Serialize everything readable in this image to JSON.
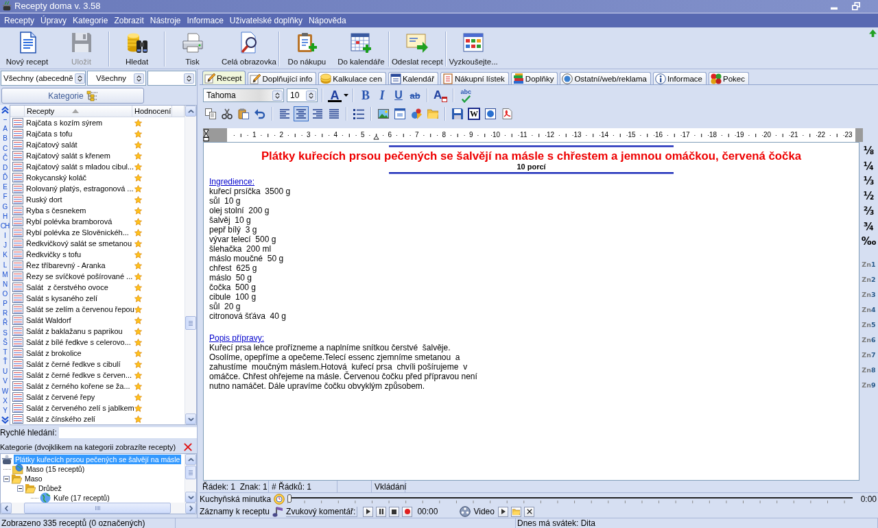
{
  "window": {
    "title": "Recepty doma v. 3.58"
  },
  "menu": [
    "Recepty",
    "Úpravy",
    "Kategorie",
    "Zobrazit",
    "Nástroje",
    "Informace",
    "Uživatelské doplňky",
    "Nápověda"
  ],
  "toolbar": {
    "groups": [
      [
        {
          "label": "Nový recept",
          "kind": "document",
          "disabled": false
        },
        {
          "label": "Uložit",
          "kind": "floppy",
          "disabled": true
        }
      ],
      [
        {
          "label": "Hledat",
          "kind": "binoculars",
          "disabled": false
        }
      ],
      [
        {
          "label": "Tisk",
          "kind": "printer",
          "disabled": false
        },
        {
          "label": "Celá obrazovka",
          "kind": "magnifier",
          "disabled": false
        }
      ],
      [
        {
          "label": "Do nákupu",
          "kind": "clipboard",
          "disabled": false
        },
        {
          "label": "Do kalendáře",
          "kind": "calendar",
          "disabled": false
        }
      ],
      [
        {
          "label": "Odeslat recept",
          "kind": "envelope",
          "disabled": false
        }
      ],
      [
        {
          "label": "Vyzkoušejte...",
          "kind": "grid",
          "disabled": false
        }
      ]
    ]
  },
  "filters": [
    "Všechny (abecedně",
    "Všechny"
  ],
  "category_button": {
    "label": "Kategorie"
  },
  "alphabet": [
    "--",
    "A",
    "B",
    "C",
    "Č",
    "D",
    "Ď",
    "E",
    "F",
    "G",
    "H",
    "CH",
    "I",
    "J",
    "K",
    "L",
    "M",
    "N",
    "O",
    "P",
    "R",
    "Ř",
    "S",
    "Š",
    "T",
    "Ť",
    "U",
    "V",
    "W",
    "X",
    "Y"
  ],
  "recipe_list": {
    "columns": [
      "Recepty",
      "Hodnocení"
    ],
    "rows": [
      {
        "name": "Rajčata s kozím sýrem"
      },
      {
        "name": "Rajčata s tofu"
      },
      {
        "name": "Rajčatový salát"
      },
      {
        "name": "Rajčatový salát s křenem"
      },
      {
        "name": "Rajčatový salát s mladou cibul..."
      },
      {
        "name": "Rokycanský koláč"
      },
      {
        "name": "Rolovaný platýs, estragonová ..."
      },
      {
        "name": "Ruský dort"
      },
      {
        "name": "Ryba s česnekem"
      },
      {
        "name": "Rybí polévka bramborová"
      },
      {
        "name": "Rybí polévka ze Slověnickéh..."
      },
      {
        "name": "Ředkvičkový salát se smetanou"
      },
      {
        "name": "Ředkvičky s tofu"
      },
      {
        "name": "Řez tříbarevný - Aranka"
      },
      {
        "name": "Řezy se svíčkové pošírované ..."
      },
      {
        "name": "Salát  z čerstvého ovoce"
      },
      {
        "name": "Salát s kysaného zelí"
      },
      {
        "name": "Salát se zelím a červenou řepou"
      },
      {
        "name": "Salát Waldorf"
      },
      {
        "name": "Salát z baklažanu s paprikou"
      },
      {
        "name": "Salát z bílé ředkve s celerovo..."
      },
      {
        "name": "Salát z brokolice"
      },
      {
        "name": "Salát z černé ředkve s cibulí"
      },
      {
        "name": "Salát z černé ředkve s červen..."
      },
      {
        "name": "Salát z černého kořene se ža..."
      },
      {
        "name": "Salát z červené řepy"
      },
      {
        "name": "Salát z červeného zelí s jablkem"
      },
      {
        "name": "Salát z čínského zelí"
      }
    ]
  },
  "quick_search": {
    "label": "Rychlé hledání:"
  },
  "category_tree": {
    "title": "Kategorie (dvojklikem na kategorii zobrazíte recepty)",
    "items": [
      {
        "label": "Plátky kuřecích prsou pečených se šalvějí na másle",
        "kind": "recipe",
        "selected": true,
        "children": [
          {
            "label": "Maso (15 receptů)",
            "kind": "linked",
            "selected": false
          },
          {
            "label": "Maso",
            "kind": "folder",
            "selected": false,
            "expanded": true,
            "children": [
              {
                "label": "Drůbež",
                "kind": "folder",
                "selected": false,
                "expanded": true,
                "children": [
                  {
                    "label": "Kuře (17 receptů)",
                    "kind": "linked-globe",
                    "selected": false
                  }
                ]
              }
            ]
          }
        ]
      }
    ]
  },
  "tabs": [
    {
      "label": "Recept",
      "kind": "pencil",
      "selected": true
    },
    {
      "label": "Doplňující info",
      "kind": "pencil",
      "selected": false
    },
    {
      "label": "Kalkulace cen",
      "kind": "coins",
      "selected": false
    },
    {
      "label": "Kalendář",
      "kind": "calendar",
      "selected": false
    },
    {
      "label": "Nákupní lístek",
      "kind": "list",
      "selected": false
    },
    {
      "label": "Doplňky",
      "kind": "books",
      "selected": false
    },
    {
      "label": "Ostatní/web/reklama",
      "kind": "globe",
      "selected": false
    },
    {
      "label": "Informace",
      "kind": "info",
      "selected": false
    },
    {
      "label": "Pokec",
      "kind": "dots",
      "selected": false
    }
  ],
  "format_bar": {
    "font": "Tahoma",
    "size": "10",
    "tools": [
      [
        {
          "kind": "font-color",
          "label": "A"
        }
      ],
      [
        {
          "kind": "bold",
          "label": "B"
        },
        {
          "kind": "italic",
          "label": "I"
        },
        {
          "kind": "underline",
          "label": "U"
        },
        {
          "kind": "strikethrough",
          "label": "ab"
        }
      ],
      [
        {
          "kind": "font-dialog",
          "label": "A"
        }
      ],
      [
        {
          "kind": "spell-check",
          "label": "abc"
        }
      ]
    ]
  },
  "editor_toolbar": {
    "groups": [
      [
        {
          "kind": "copy"
        },
        {
          "kind": "cut"
        },
        {
          "kind": "paste"
        },
        {
          "kind": "undo"
        }
      ],
      [
        {
          "kind": "align-left",
          "selected": false
        },
        {
          "kind": "align-center",
          "selected": true
        },
        {
          "kind": "align-right",
          "selected": false
        },
        {
          "kind": "justify",
          "selected": false
        }
      ],
      [
        {
          "kind": "bullets"
        }
      ],
      [
        {
          "kind": "image"
        },
        {
          "kind": "form"
        },
        {
          "kind": "object"
        },
        {
          "kind": "folder"
        }
      ],
      [
        {
          "kind": "save"
        },
        {
          "kind": "word",
          "label": "W"
        },
        {
          "kind": "web"
        },
        {
          "kind": "pdf"
        }
      ]
    ]
  },
  "ruler": {
    "numbers": [
      "1",
      "2",
      "3",
      "4",
      "5",
      "6",
      "7",
      "8",
      "9",
      "10",
      "11",
      "12",
      "13",
      "14",
      "15",
      "16",
      "17",
      "18",
      "19",
      "20",
      "21",
      "22",
      "23"
    ]
  },
  "document": {
    "title": "Plátky kuřecích prsou pečených se šalvějí na másle s chřestem a jemnou omáčkou, červená čočka",
    "servings": "10 porcí",
    "ingredients_heading": "Ingredience:",
    "ingredients": [
      "kuřecí prsíčka  3500 g",
      "sůl  10 g",
      "olej stolní  200 g",
      "šalvěj  10 g",
      "pepř bílý  3 g",
      "vývar telecí  500 g",
      "šlehačka  200 ml",
      "máslo moučné  50 g",
      "chřest  625 g",
      "máslo  50 g",
      "čočka  500 g",
      "cibule  100 g",
      "sůl  20 g",
      "citronová šťáva  40 g"
    ],
    "method_heading": "Popis přípravy:",
    "method": [
      "Kuřecí prsa lehce prořízneme a naplníme snítkou čerstvé  šalvěje.",
      "Osolíme, opepříme a opečeme.Telecí essenc zjemníme smetanou  a",
      "zahustíme  moučným máslem.Hotová  kuřecí prsa  chvíli pošírujeme  v",
      "omáčce. Chřest ohřejeme na másle. Červenou čočku před přípravou není",
      "nutno namáčet. Dále upravíme čočku obvyklým způsobem."
    ]
  },
  "fractions": [
    "⅛",
    "¼",
    "⅓",
    "½",
    "⅔",
    "¾",
    "‰"
  ],
  "zones": [
    {
      "prefix": "Zn",
      "number": "1"
    },
    {
      "prefix": "Zn",
      "number": "2"
    },
    {
      "prefix": "Zn",
      "number": "3"
    },
    {
      "prefix": "Zn",
      "number": "4"
    },
    {
      "prefix": "Zn",
      "number": "5"
    },
    {
      "prefix": "Zn",
      "number": "6"
    },
    {
      "prefix": "Zn",
      "number": "7"
    },
    {
      "prefix": "Zn",
      "number": "8"
    },
    {
      "prefix": "Zn",
      "number": "9"
    }
  ],
  "editor_status": {
    "position": "Řádek: 1  Znak: 1",
    "line_count": "# Řádků: 1",
    "mode": "Vkládání"
  },
  "timer": {
    "label": "Kuchyňská minutka",
    "level": 0,
    "reading": "0:00"
  },
  "recordings": {
    "label": "Záznamy k receptu",
    "audio_label": "Zvukový komentář:",
    "audio_time": "00:00",
    "video_label": "Video"
  },
  "status_bar": {
    "count": "Zobrazeno 335 receptů (0 označených)",
    "nameday": "Dnes má svátek: Dita"
  }
}
